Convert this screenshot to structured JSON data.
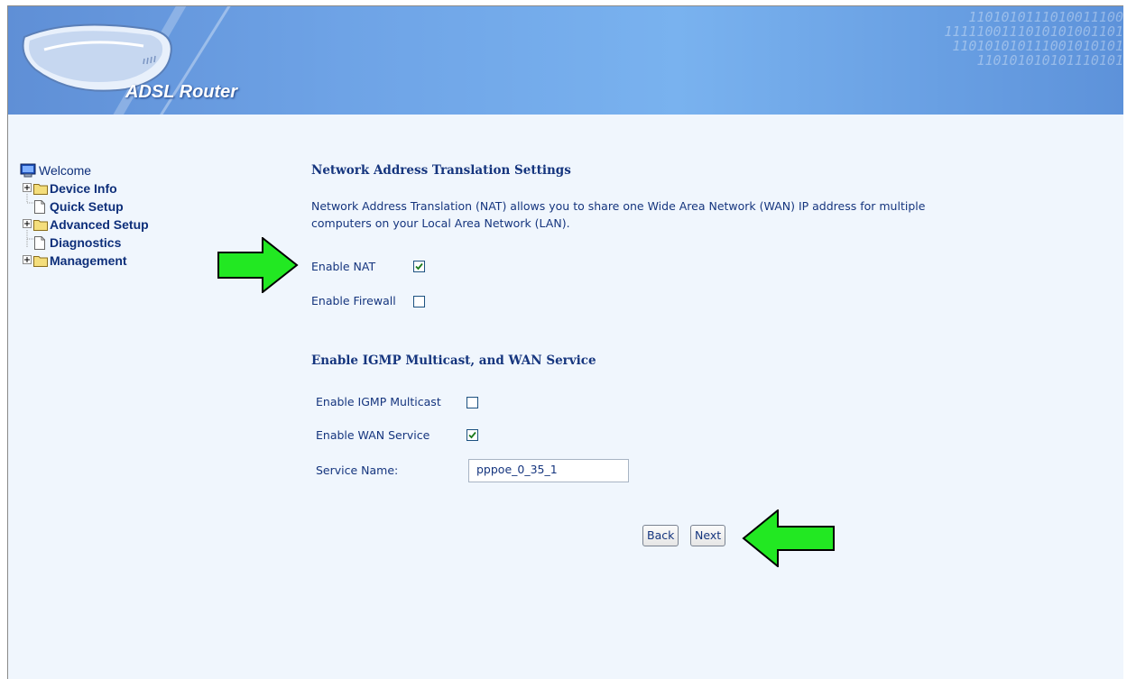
{
  "banner": {
    "brand": "ADSL Router",
    "binary_lines": [
      "1101010111010011100",
      "1111100111010101001101",
      "110101010111001010101",
      "110101010101110101"
    ]
  },
  "nav": {
    "items": [
      {
        "label": "Welcome",
        "icon": "computer-icon"
      },
      {
        "label": "Device Info",
        "icon": "folder-icon",
        "expandable": true
      },
      {
        "label": "Quick Setup",
        "icon": "page-icon"
      },
      {
        "label": "Advanced Setup",
        "icon": "folder-icon",
        "expandable": true
      },
      {
        "label": "Diagnostics",
        "icon": "page-icon"
      },
      {
        "label": "Management",
        "icon": "folder-icon",
        "expandable": true
      }
    ]
  },
  "nat": {
    "heading": "Network Address Translation Settings",
    "description_line1": "Network Address Translation (NAT) allows you to share one Wide Area Network (WAN) IP address for multiple",
    "description_line2": "computers on your Local Area Network (LAN).",
    "enable_nat_label": "Enable NAT",
    "enable_nat_checked": true,
    "enable_firewall_label": "Enable Firewall",
    "enable_firewall_checked": false
  },
  "igmp": {
    "heading": "Enable IGMP Multicast, and WAN Service",
    "igmp_label": "Enable IGMP Multicast",
    "igmp_checked": false,
    "wan_label": "Enable WAN Service",
    "wan_checked": true,
    "service_name_label": "Service Name:",
    "service_name_value": "pppoe_0_35_1"
  },
  "buttons": {
    "back": "Back",
    "next": "Next"
  },
  "colors": {
    "text": "#15357e",
    "background": "#f0f6fd",
    "arrow_fill": "#22e822"
  }
}
